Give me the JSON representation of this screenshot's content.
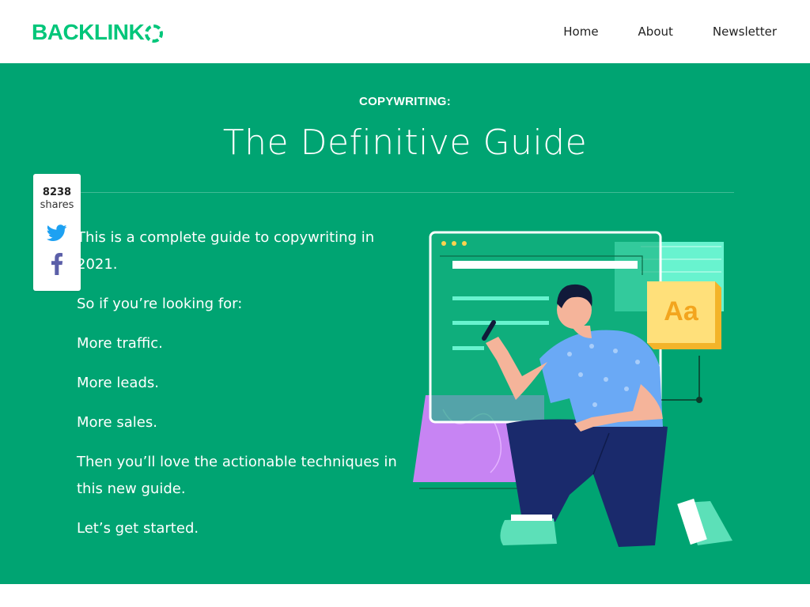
{
  "brand": {
    "logo_text": "BACKLINK",
    "logo_text_last": "O"
  },
  "nav": {
    "items": [
      "Home",
      "About",
      "Newsletter"
    ]
  },
  "share": {
    "count": "8238",
    "label": "shares",
    "icons": [
      "twitter-icon",
      "facebook-icon"
    ]
  },
  "hero": {
    "kicker": "COPYWRITING:",
    "title": "The Definitive Guide",
    "paragraphs": [
      "This is a complete guide to copywriting in 2021.",
      "So if you’re looking for:",
      "More traffic.",
      "More leads.",
      "More sales.",
      "Then you’ll love the actionable techniques in this new guide.",
      "Let’s get started."
    ],
    "illustration_badge": "Aa"
  },
  "colors": {
    "brand_green": "#00c67a",
    "hero_bg": "#00a472",
    "twitter_blue": "#1da1f2",
    "facebook_purple": "#5b5fa8",
    "badge_yellow": "#fdd24e",
    "shirt_blue": "#6aa9f5",
    "pants_navy": "#1a2a6c",
    "accent_mint": "#68f3cf",
    "accent_violet": "#c784f3"
  }
}
